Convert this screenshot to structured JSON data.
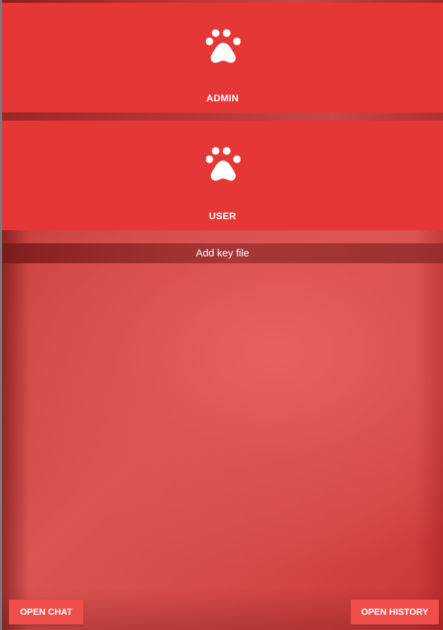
{
  "roles": [
    {
      "label": "ADMIN",
      "icon": "paw-icon"
    },
    {
      "label": "USER",
      "icon": "paw-icon"
    }
  ],
  "key_file": {
    "label": "Add key file"
  },
  "footer": {
    "open_chat_label": "OPEN CHAT",
    "open_history_label": "OPEN HISTORY"
  },
  "colors": {
    "card_red": "#e53735",
    "button_red": "#ef4e4b",
    "text": "#ffffff"
  }
}
